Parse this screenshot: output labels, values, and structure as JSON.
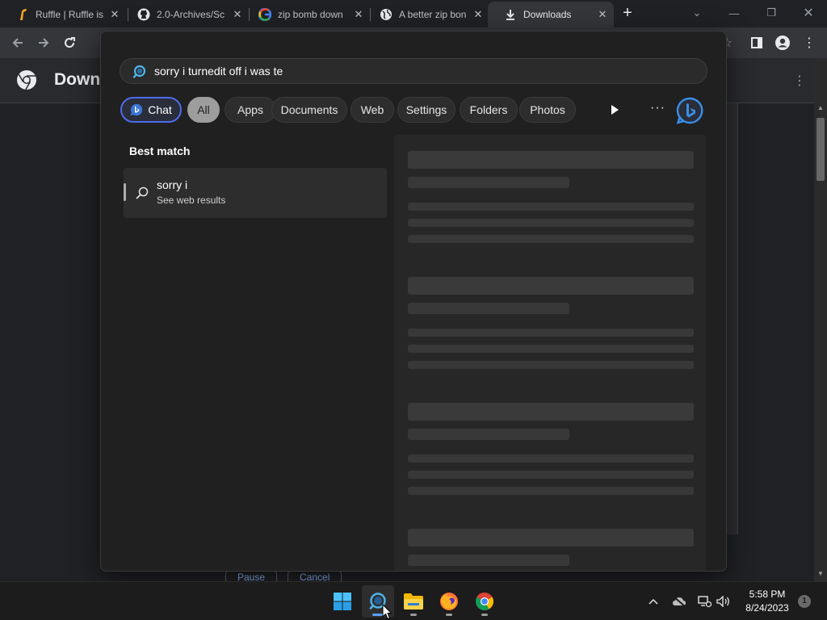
{
  "browser": {
    "tabs": [
      {
        "title": "Ruffle | Ruffle is",
        "icon": "ruffle-icon"
      },
      {
        "title": "2.0-Archives/Sc",
        "icon": "github-icon"
      },
      {
        "title": "zip bomb down",
        "icon": "google-icon"
      },
      {
        "title": "A better zip bon",
        "icon": "globe-icon"
      },
      {
        "title": "Downloads",
        "icon": "download-icon",
        "active": true
      }
    ],
    "new_tab_label": "+"
  },
  "page": {
    "title": "Down",
    "buttons": [
      "Pause",
      "Cancel"
    ]
  },
  "search": {
    "query": "sorry i turnedit off i was te",
    "filters": [
      {
        "label": "Chat",
        "icon": "bing-chat-icon"
      },
      {
        "label": "All",
        "selected": true
      },
      {
        "label": "Apps"
      },
      {
        "label": "Documents"
      },
      {
        "label": "Web"
      },
      {
        "label": "Settings"
      },
      {
        "label": "Folders"
      },
      {
        "label": "Photos"
      }
    ],
    "best_match_label": "Best match",
    "best_match": {
      "title": "sorry i",
      "subtitle": "See web results"
    }
  },
  "taskbar": {
    "apps": [
      "start-icon",
      "search-icon",
      "file-explorer-icon",
      "firefox-icon",
      "chrome-icon"
    ],
    "time": "5:58 PM",
    "date": "8/24/2023",
    "notification_count": "1"
  },
  "colors": {
    "accent_blue": "#4f6bed",
    "selected_chip": "#9d9d9d",
    "panel_bg": "#202020"
  }
}
